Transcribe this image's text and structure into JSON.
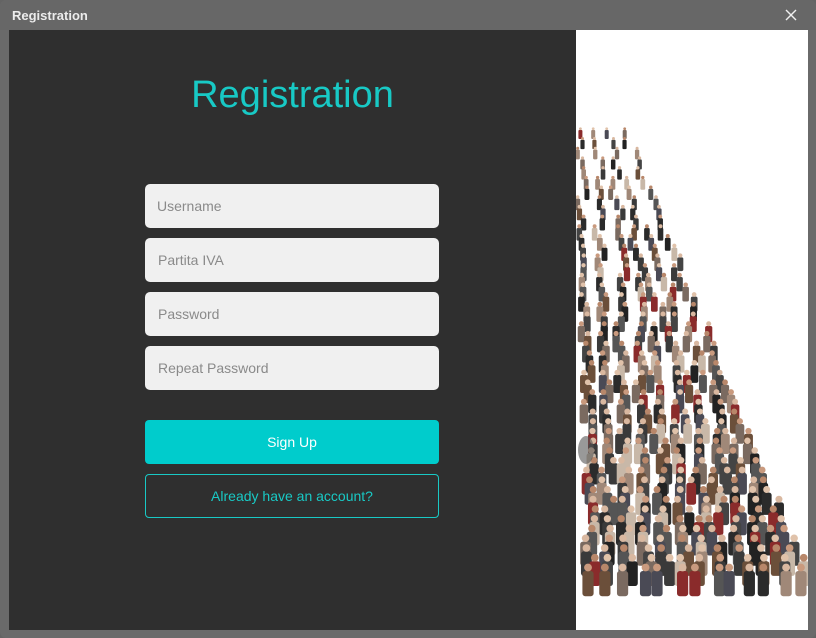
{
  "window": {
    "title": "Registration"
  },
  "form": {
    "heading": "Registration",
    "username_placeholder": "Username",
    "partita_iva_placeholder": "Partita IVA",
    "password_placeholder": "Password",
    "repeat_password_placeholder": "Repeat Password",
    "signup_label": "Sign Up",
    "login_link_label": "Already have an account?"
  },
  "colors": {
    "accent": "#00cccc",
    "panel": "#2f2f2f",
    "titlebar": "#676767",
    "field": "#f0f0f0"
  },
  "image": {
    "subject": "crowd of people walking"
  }
}
